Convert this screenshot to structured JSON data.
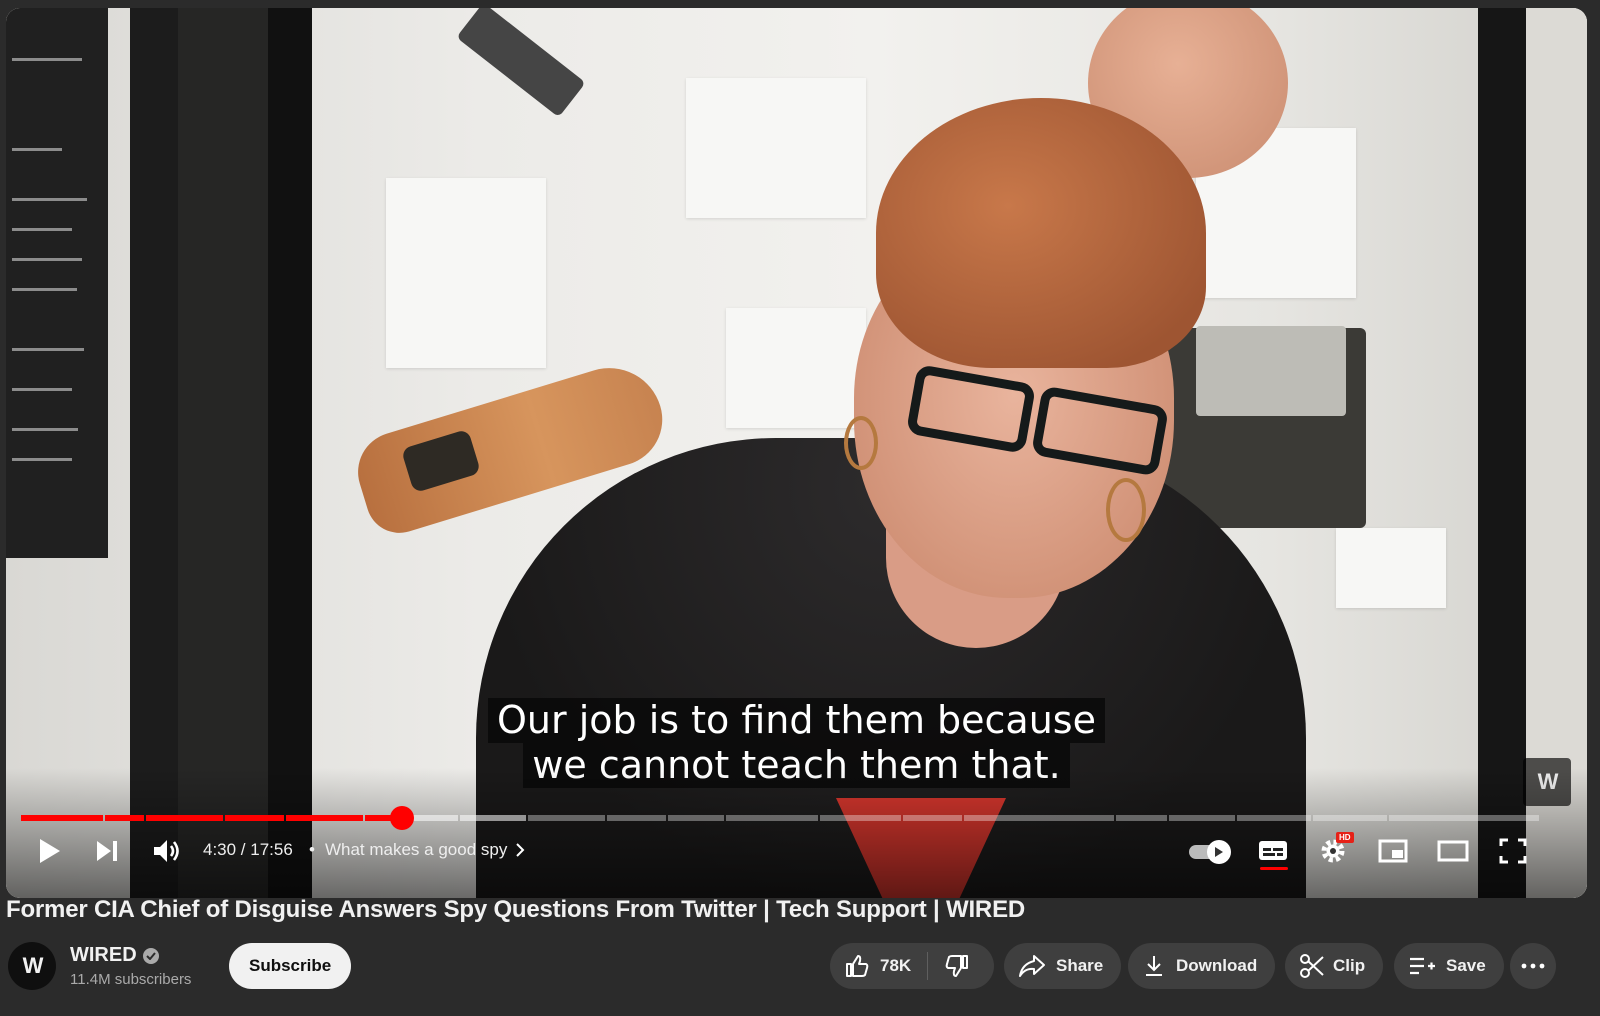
{
  "video": {
    "captions": [
      "Our job is to find them because",
      "we cannot teach them that."
    ],
    "watermark_text": "W",
    "progress": {
      "current": "4:30",
      "duration": "17:56",
      "played_fraction": 0.2507,
      "loaded_fraction": 0.29
    },
    "time_label": "4:30 / 17:56",
    "chapter_sep": "•",
    "chapter": "What makes a good spy",
    "hd_badge": "HD",
    "icons": [
      "play-icon",
      "next-icon",
      "volume-icon",
      "chevron-right-icon",
      "autoplay-toggle",
      "subtitles-icon",
      "settings-icon",
      "miniplayer-icon",
      "theater-icon",
      "fullscreen-icon"
    ]
  },
  "title": "Former CIA Chief of Disguise Answers Spy Questions From Twitter | Tech Support | WIRED",
  "channel": {
    "name": "WIRED",
    "avatar_text": "W",
    "subscribers": "11.4M subscribers",
    "subscribe_label": "Subscribe"
  },
  "actions": {
    "likes": "78K",
    "share": "Share",
    "download": "Download",
    "clip": "Clip",
    "save": "Save"
  },
  "colors": {
    "accent": "#ff0000",
    "background": "#2b2b2b",
    "pill": "#3f3f3f"
  }
}
